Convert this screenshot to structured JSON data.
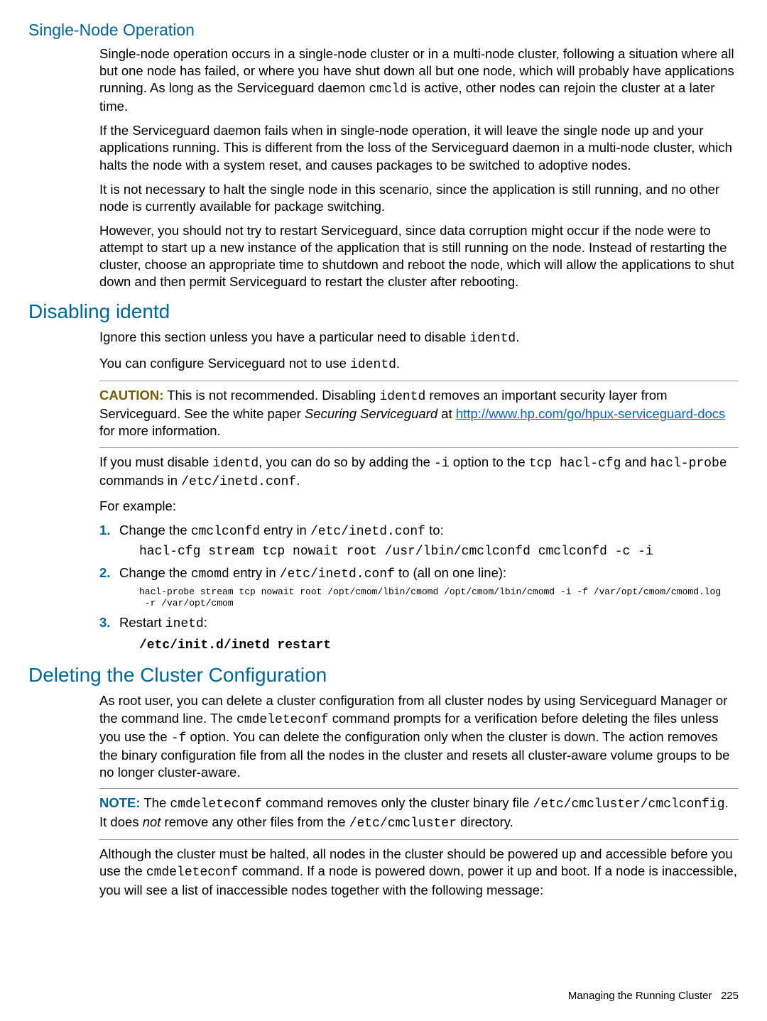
{
  "section1": {
    "heading": "Single-Node Operation",
    "p1a": "Single-node operation occurs in a single-node cluster or in a multi-node cluster, following a situation where all but one node has failed, or where you have shut down all but one node, which will probably have applications running. As long as the Serviceguard daemon ",
    "p1code": "cmcld",
    "p1b": " is active, other nodes can rejoin the cluster at a later time.",
    "p2": "If the Serviceguard daemon fails when in single-node operation, it will leave the single node up and your applications running. This is different from the loss of the Serviceguard daemon in a multi-node cluster, which halts the node with a system reset, and causes packages to be switched to adoptive nodes.",
    "p3": "It is not necessary to halt the single node in this scenario, since the application is still running, and no other node is currently available for package switching.",
    "p4": "However, you should not try to restart Serviceguard, since data corruption might occur if the node were to attempt to start up a new instance of the application that is still running on the node. Instead of restarting the cluster, choose an appropriate time to shutdown and reboot the node, which will allow the applications to shut down and then permit Serviceguard to restart the cluster after rebooting."
  },
  "section2": {
    "heading": "Disabling identd",
    "p1a": "Ignore this section unless you have a particular need to disable ",
    "p1code": "identd",
    "p1b": ".",
    "p2a": "You can configure Serviceguard not to use ",
    "p2code": "identd",
    "p2b": ".",
    "caution": {
      "label": "CAUTION:",
      "t1": "   This is not recommended. Disabling ",
      "c1": "identd",
      "t2": " removes an important security layer from Serviceguard. See the white paper ",
      "it": "Securing Serviceguard",
      "t3": " at ",
      "link1": "http://www.hp.com/go/hpux-serviceguard-docs",
      "t4": " for more information."
    },
    "p3": {
      "t1": "If you must disable ",
      "c1": "identd",
      "t2": ", you can do so by adding the ",
      "c2": "-i",
      "t3": " option to the ",
      "c3": "tcp hacl-cfg",
      "t4": " and ",
      "c4": "hacl-probe",
      "t5": " commands in ",
      "c5": "/etc/inetd.conf",
      "t6": "."
    },
    "p4": "For example:",
    "step1": {
      "num": "1.",
      "t1": "Change the ",
      "c1": "cmclconfd",
      "t2": " entry in ",
      "c2": "/etc/inetd.conf",
      "t3": " to:",
      "code": "hacl-cfg stream tcp nowait root /usr/lbin/cmclconfd cmclconfd -c -i"
    },
    "step2": {
      "num": "2.",
      "t1": "Change the ",
      "c1": "cmomd",
      "t2": " entry in ",
      "c2": "/etc/inetd.conf",
      "t3": " to (all on one line):",
      "code": "hacl-probe stream tcp nowait root /opt/cmom/lbin/cmomd /opt/cmom/lbin/cmomd -i -f /var/opt/cmom/cmomd.log\n -r /var/opt/cmom"
    },
    "step3": {
      "num": "3.",
      "t1": "Restart ",
      "c1": "inetd",
      "t2": ":",
      "code": "/etc/init.d/inetd restart"
    }
  },
  "section3": {
    "heading": "Deleting the Cluster Configuration",
    "p1": {
      "t1": "As root user, you can delete a cluster configuration from all cluster nodes by using Serviceguard Manager or the command line. The ",
      "c1": "cmdeleteconf",
      "t2": " command prompts for a verification before deleting the files unless you use the ",
      "c2": "-f",
      "t3": " option. You can delete the configuration only when the cluster is down. The action removes the binary configuration file from all the nodes in the cluster and resets all cluster-aware volume groups to be no longer cluster-aware."
    },
    "note": {
      "label": "NOTE:",
      "t1": "   The ",
      "c1": "cmdeleteconf",
      "t2": " command removes only the cluster binary file ",
      "c2": "/etc/cmcluster/cmclconfig",
      "t3": ". It does ",
      "it": "not",
      "t4": " remove any other files from the ",
      "c3": "/etc/cmcluster",
      "t5": " directory."
    },
    "p2": {
      "t1": "Although the cluster must be halted, all nodes in the cluster should be powered up and accessible before you use the ",
      "c1": "cmdeleteconf",
      "t2": " command. If a node is powered down, power it up and boot. If a node is inaccessible, you will see a list of inaccessible nodes together with the following message:"
    }
  },
  "footer": {
    "text": "Managing the Running Cluster",
    "page": "225"
  }
}
